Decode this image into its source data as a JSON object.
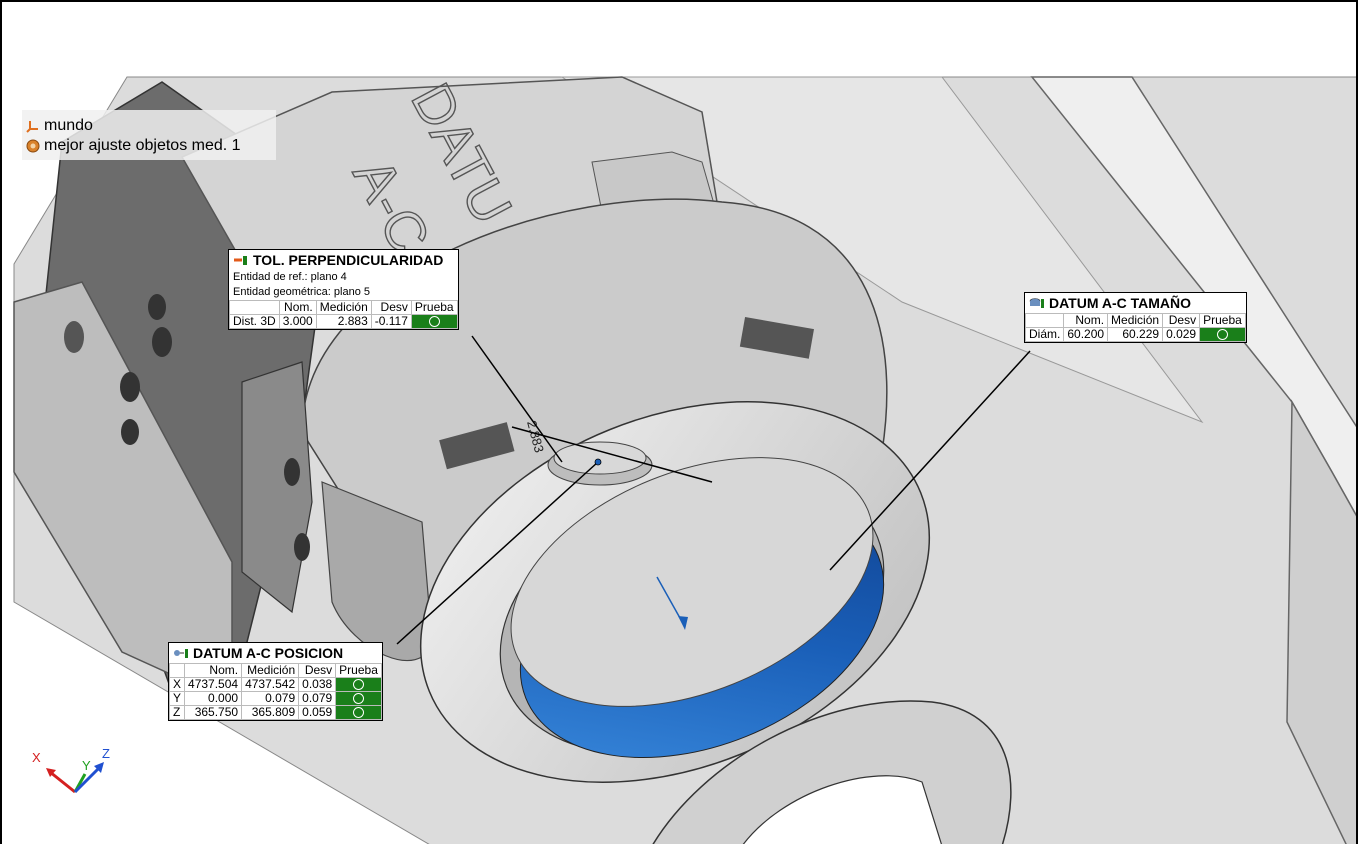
{
  "legend": {
    "items": [
      {
        "label": "mundo",
        "icon": "coordinate-system-icon"
      },
      {
        "label": "mejor ajuste objetos med. 1",
        "icon": "best-fit-icon"
      }
    ]
  },
  "part_label": {
    "line1": "DATU",
    "line2": "A-C"
  },
  "dim_marker": "2.883",
  "perpendicularidad": {
    "title": "TOL. PERPENDICULARIDAD",
    "ref_entity": "Entidad de ref.: plano 4",
    "geo_entity": "Entidad geométrica: plano 5",
    "headers": [
      "",
      "Nom.",
      "Medición",
      "Desv",
      "Prueba"
    ],
    "rows": [
      {
        "label": "Dist. 3D",
        "nom": "3.000",
        "med": "2.883",
        "desv": "-0.117"
      }
    ]
  },
  "tamano": {
    "title": "DATUM A-C TAMAÑO",
    "headers": [
      "",
      "Nom.",
      "Medición",
      "Desv",
      "Prueba"
    ],
    "rows": [
      {
        "label": "Diám.",
        "nom": "60.200",
        "med": "60.229",
        "desv": "0.029"
      }
    ]
  },
  "posicion": {
    "title": "DATUM A-C POSICION",
    "headers": [
      "",
      "Nom.",
      "Medición",
      "Desv",
      "Prueba"
    ],
    "rows": [
      {
        "label": "X",
        "nom": "4737.504",
        "med": "4737.542",
        "desv": "0.038"
      },
      {
        "label": "Y",
        "nom": "0.000",
        "med": "0.079",
        "desv": "0.079"
      },
      {
        "label": "Z",
        "nom": "365.750",
        "med": "365.809",
        "desv": "0.059"
      }
    ]
  },
  "axes": {
    "x": "X",
    "y": "Y",
    "z": "Z"
  },
  "colors": {
    "pass": "#1a7f1a",
    "highlight": "#1a5fb8",
    "part": "#d8d8d8"
  }
}
